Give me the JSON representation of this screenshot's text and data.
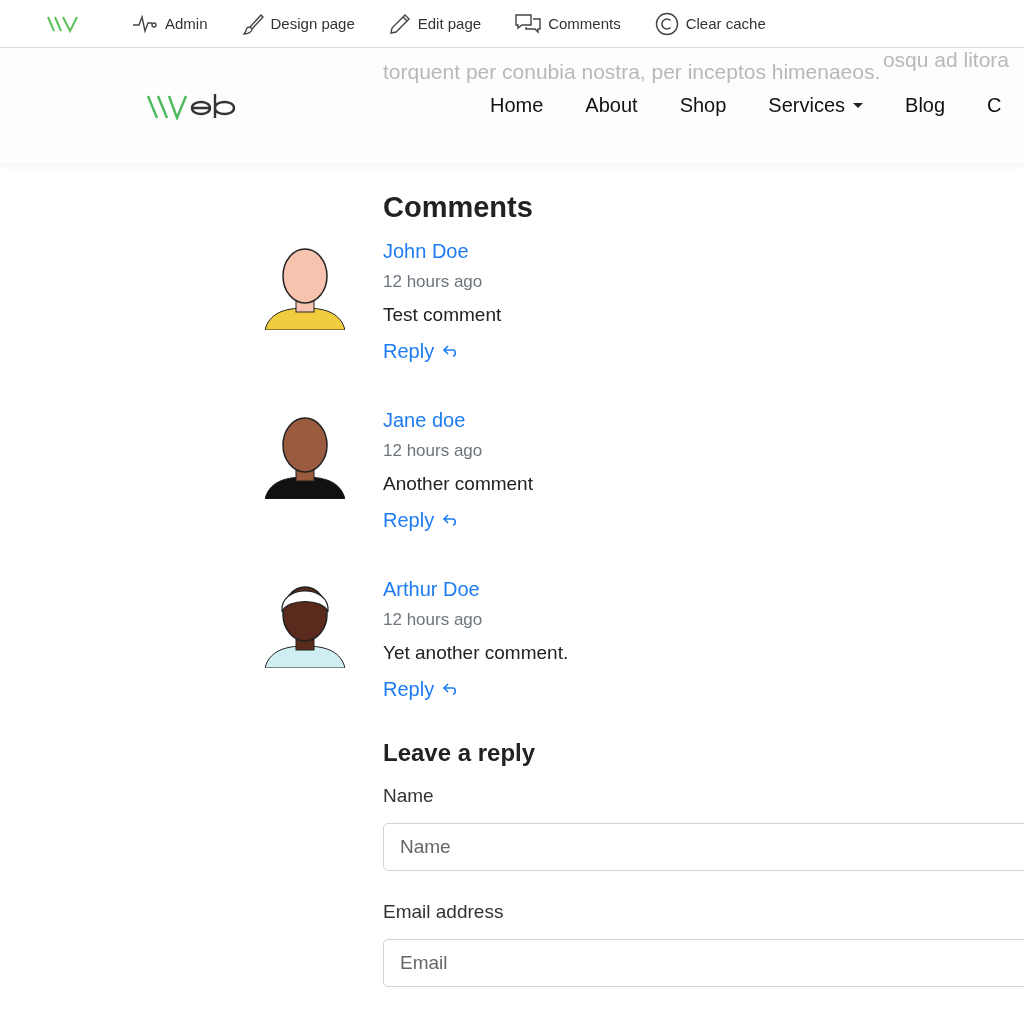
{
  "admin_bar": {
    "items": [
      {
        "kind": "pulse",
        "label": "Admin"
      },
      {
        "kind": "brush",
        "label": "Design page"
      },
      {
        "kind": "pencil",
        "label": "Edit page"
      },
      {
        "kind": "comments",
        "label": "Comments"
      },
      {
        "kind": "copyright",
        "label": "Clear cache"
      }
    ]
  },
  "background_text": [
    "osqu ad litora",
    "torquent per conubia nostra, per inceptos himenaeos."
  ],
  "nav": {
    "items": [
      {
        "label": "Home",
        "dropdown": false
      },
      {
        "label": "About",
        "dropdown": false
      },
      {
        "label": "Shop",
        "dropdown": false
      },
      {
        "label": "Services",
        "dropdown": true
      },
      {
        "label": "Blog",
        "dropdown": false
      },
      {
        "label": "C",
        "dropdown": false
      }
    ]
  },
  "comments": {
    "title": "Comments",
    "items": [
      {
        "author": "John Doe",
        "time": "12 hours ago",
        "text": "Test comment",
        "reply": "Reply"
      },
      {
        "author": "Jane doe",
        "time": "12 hours ago",
        "text": "Another comment",
        "reply": "Reply"
      },
      {
        "author": "Arthur Doe",
        "time": "12 hours ago",
        "text": "Yet another comment.",
        "reply": "Reply"
      }
    ]
  },
  "reply_form": {
    "title": "Leave a reply",
    "fields": [
      {
        "label": "Name",
        "placeholder": "Name"
      },
      {
        "label": "Email address",
        "placeholder": "Email"
      }
    ]
  }
}
